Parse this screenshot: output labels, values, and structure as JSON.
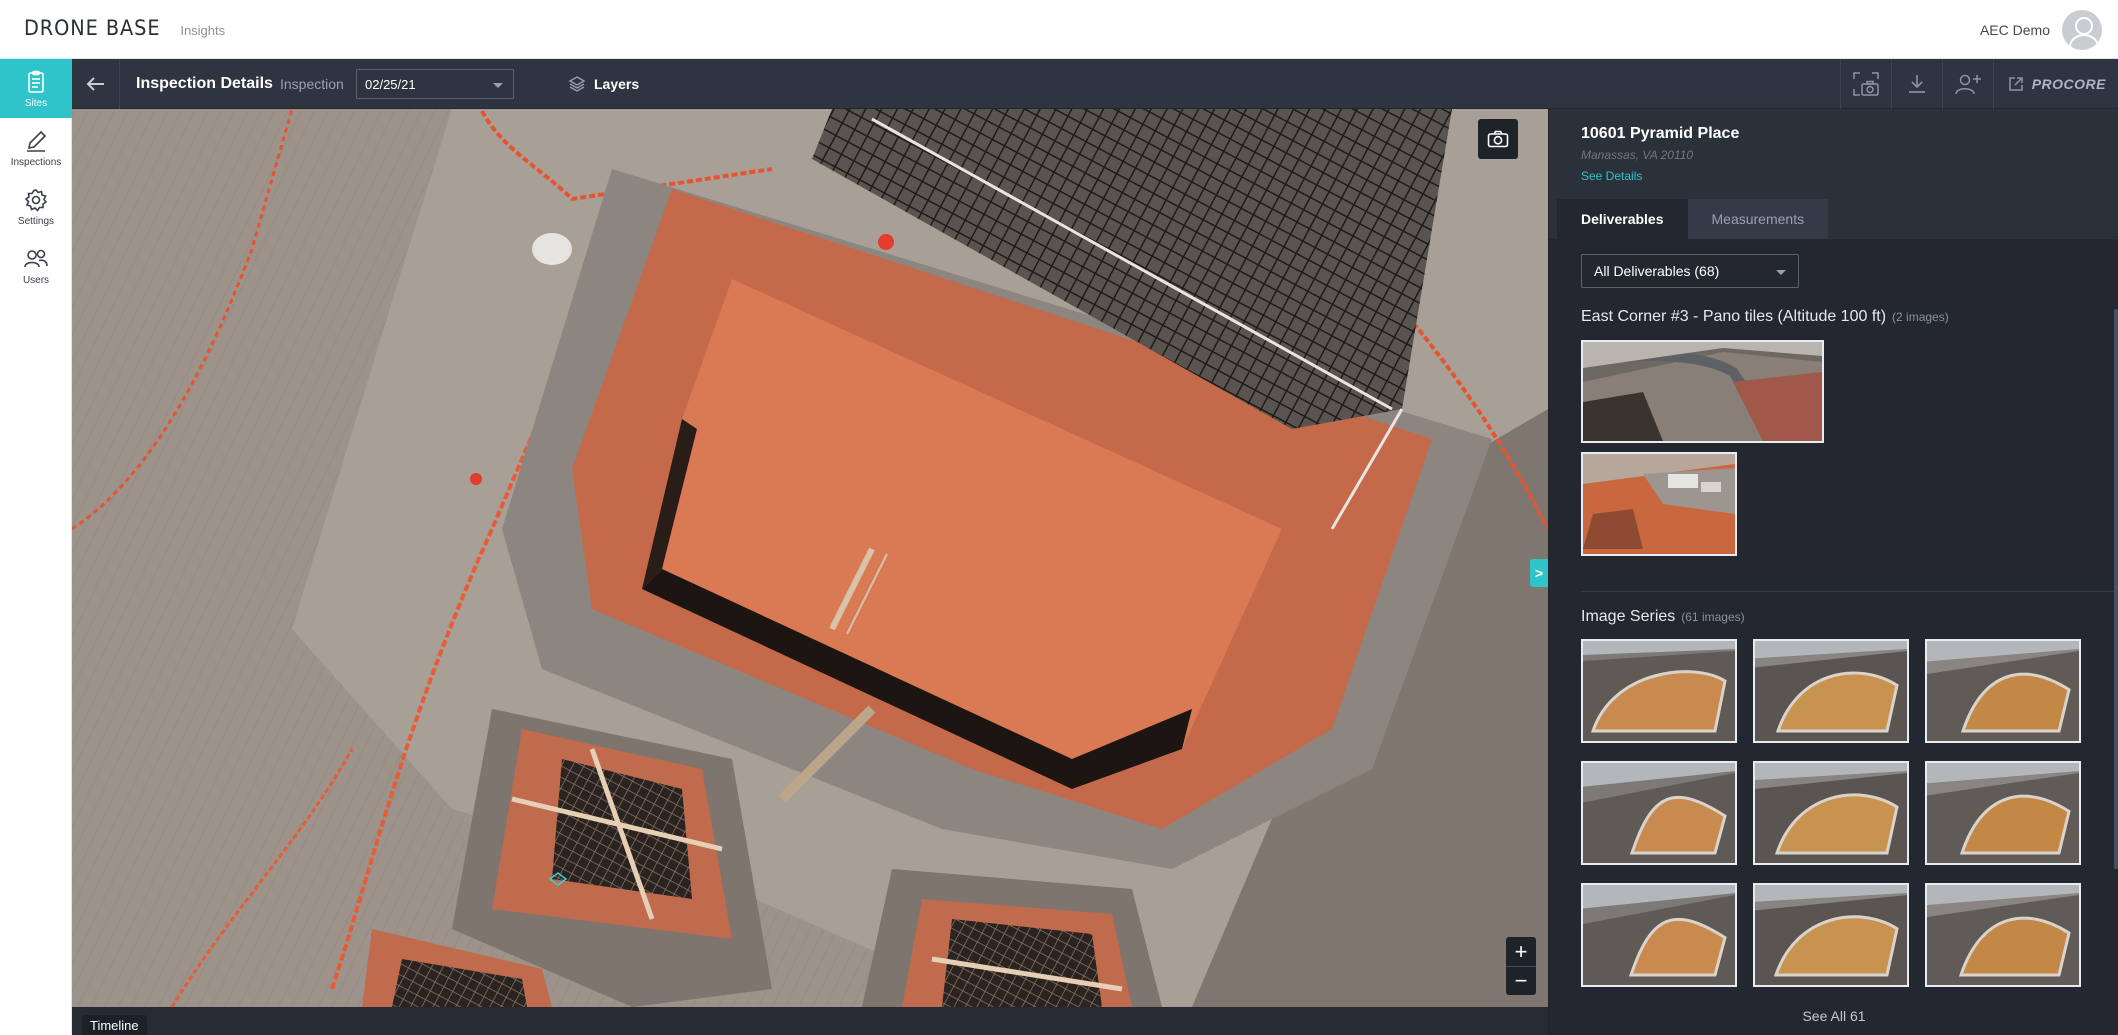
{
  "brand": {
    "name": "DRONE BASE",
    "sub": "Insights"
  },
  "account": {
    "name": "AEC Demo"
  },
  "sidenav": {
    "items": [
      {
        "label": "Sites",
        "icon": "clipboard-icon"
      },
      {
        "label": "Inspections",
        "icon": "pencil-icon"
      },
      {
        "label": "Settings",
        "icon": "gear-icon"
      },
      {
        "label": "Users",
        "icon": "users-icon"
      }
    ]
  },
  "toolbar": {
    "title": "Inspection Details",
    "inspection_label": "Inspection",
    "inspection_date": "02/25/21",
    "layers_label": "Layers",
    "procore_label": "PROCORE"
  },
  "site": {
    "name": "10601 Pyramid Place",
    "address": "Manassas, VA 20110",
    "details_link": "See Details"
  },
  "tabs": [
    {
      "label": "Deliverables",
      "active": true
    },
    {
      "label": "Measurements",
      "active": false
    }
  ],
  "deliverables_filter": "All Deliverables (68)",
  "sections": {
    "pano": {
      "title": "East Corner #3 - Pano tiles (Altitude 100 ft)",
      "count": "(2 images)"
    },
    "series": {
      "title": "Image Series",
      "count": "(61 images)"
    }
  },
  "see_all": "See All 61",
  "timeline_label": "Timeline",
  "map": {
    "panel_toggle": ">",
    "zoom_in": "+",
    "zoom_out": "−"
  },
  "colors": {
    "accent": "#2fc4c9",
    "toolbar_bg": "#2e3440",
    "panel_bg": "#232830"
  }
}
